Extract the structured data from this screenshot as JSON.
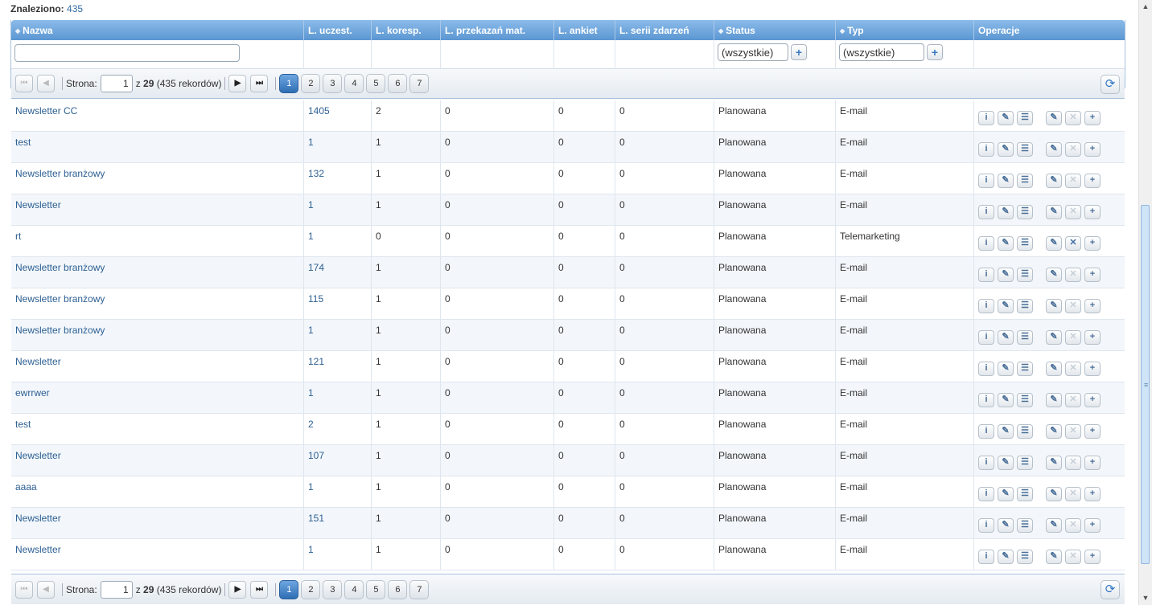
{
  "found": {
    "label": "Znaleziono:",
    "count": "435"
  },
  "columns": [
    "Nazwa",
    "L. uczest.",
    "L. koresp.",
    "L. przekazań mat.",
    "L. ankiet",
    "L. serii zdarzeń",
    "Status",
    "Typ",
    "Operacje"
  ],
  "filters": {
    "status_value": "(wszystkie)",
    "type_value": "(wszystkie)",
    "plus_label": "+"
  },
  "pager": {
    "page_label": "Strona:",
    "current_page": "1",
    "of_label": "z",
    "total_pages": "29",
    "records_text": "(435 rekordów)",
    "pages": [
      "1",
      "2",
      "3",
      "4",
      "5",
      "6",
      "7"
    ]
  },
  "icons": {
    "first": "first-page-icon",
    "prev": "prev-page-icon",
    "next": "next-page-icon",
    "last": "last-page-icon",
    "refresh": "refresh-icon",
    "info": "info-icon",
    "edit": "pencil-icon",
    "list": "list-icon",
    "delete": "delete-icon",
    "add": "plus-icon"
  },
  "rows": [
    {
      "name": "Newsletter CC",
      "participants": "1405",
      "correspondence": "2",
      "materials": "0",
      "surveys": "0",
      "series": "0",
      "status": "Planowana",
      "type": "E-mail",
      "delete_enabled": false
    },
    {
      "name": "test",
      "participants": "1",
      "correspondence": "1",
      "materials": "0",
      "surveys": "0",
      "series": "0",
      "status": "Planowana",
      "type": "E-mail",
      "delete_enabled": false
    },
    {
      "name": "Newsletter branżowy",
      "participants": "132",
      "correspondence": "1",
      "materials": "0",
      "surveys": "0",
      "series": "0",
      "status": "Planowana",
      "type": "E-mail",
      "delete_enabled": false
    },
    {
      "name": "Newsletter",
      "participants": "1",
      "correspondence": "1",
      "materials": "0",
      "surveys": "0",
      "series": "0",
      "status": "Planowana",
      "type": "E-mail",
      "delete_enabled": false
    },
    {
      "name": "rt",
      "participants": "1",
      "correspondence": "0",
      "materials": "0",
      "surveys": "0",
      "series": "0",
      "status": "Planowana",
      "type": "Telemarketing",
      "delete_enabled": true
    },
    {
      "name": "Newsletter branżowy",
      "participants": "174",
      "correspondence": "1",
      "materials": "0",
      "surveys": "0",
      "series": "0",
      "status": "Planowana",
      "type": "E-mail",
      "delete_enabled": false
    },
    {
      "name": "Newsletter branżowy",
      "participants": "115",
      "correspondence": "1",
      "materials": "0",
      "surveys": "0",
      "series": "0",
      "status": "Planowana",
      "type": "E-mail",
      "delete_enabled": false
    },
    {
      "name": "Newsletter branżowy",
      "participants": "1",
      "correspondence": "1",
      "materials": "0",
      "surveys": "0",
      "series": "0",
      "status": "Planowana",
      "type": "E-mail",
      "delete_enabled": false
    },
    {
      "name": "Newsletter",
      "participants": "121",
      "correspondence": "1",
      "materials": "0",
      "surveys": "0",
      "series": "0",
      "status": "Planowana",
      "type": "E-mail",
      "delete_enabled": false
    },
    {
      "name": "ewrrwer",
      "participants": "1",
      "correspondence": "1",
      "materials": "0",
      "surveys": "0",
      "series": "0",
      "status": "Planowana",
      "type": "E-mail",
      "delete_enabled": false
    },
    {
      "name": "test",
      "participants": "2",
      "correspondence": "1",
      "materials": "0",
      "surveys": "0",
      "series": "0",
      "status": "Planowana",
      "type": "E-mail",
      "delete_enabled": false
    },
    {
      "name": "Newsletter",
      "participants": "107",
      "correspondence": "1",
      "materials": "0",
      "surveys": "0",
      "series": "0",
      "status": "Planowana",
      "type": "E-mail",
      "delete_enabled": false
    },
    {
      "name": "aaaa",
      "participants": "1",
      "correspondence": "1",
      "materials": "0",
      "surveys": "0",
      "series": "0",
      "status": "Planowana",
      "type": "E-mail",
      "delete_enabled": false
    },
    {
      "name": "Newsletter",
      "participants": "151",
      "correspondence": "1",
      "materials": "0",
      "surveys": "0",
      "series": "0",
      "status": "Planowana",
      "type": "E-mail",
      "delete_enabled": false
    },
    {
      "name": "Newsletter",
      "participants": "1",
      "correspondence": "1",
      "materials": "0",
      "surveys": "0",
      "series": "0",
      "status": "Planowana",
      "type": "E-mail",
      "delete_enabled": false
    }
  ]
}
